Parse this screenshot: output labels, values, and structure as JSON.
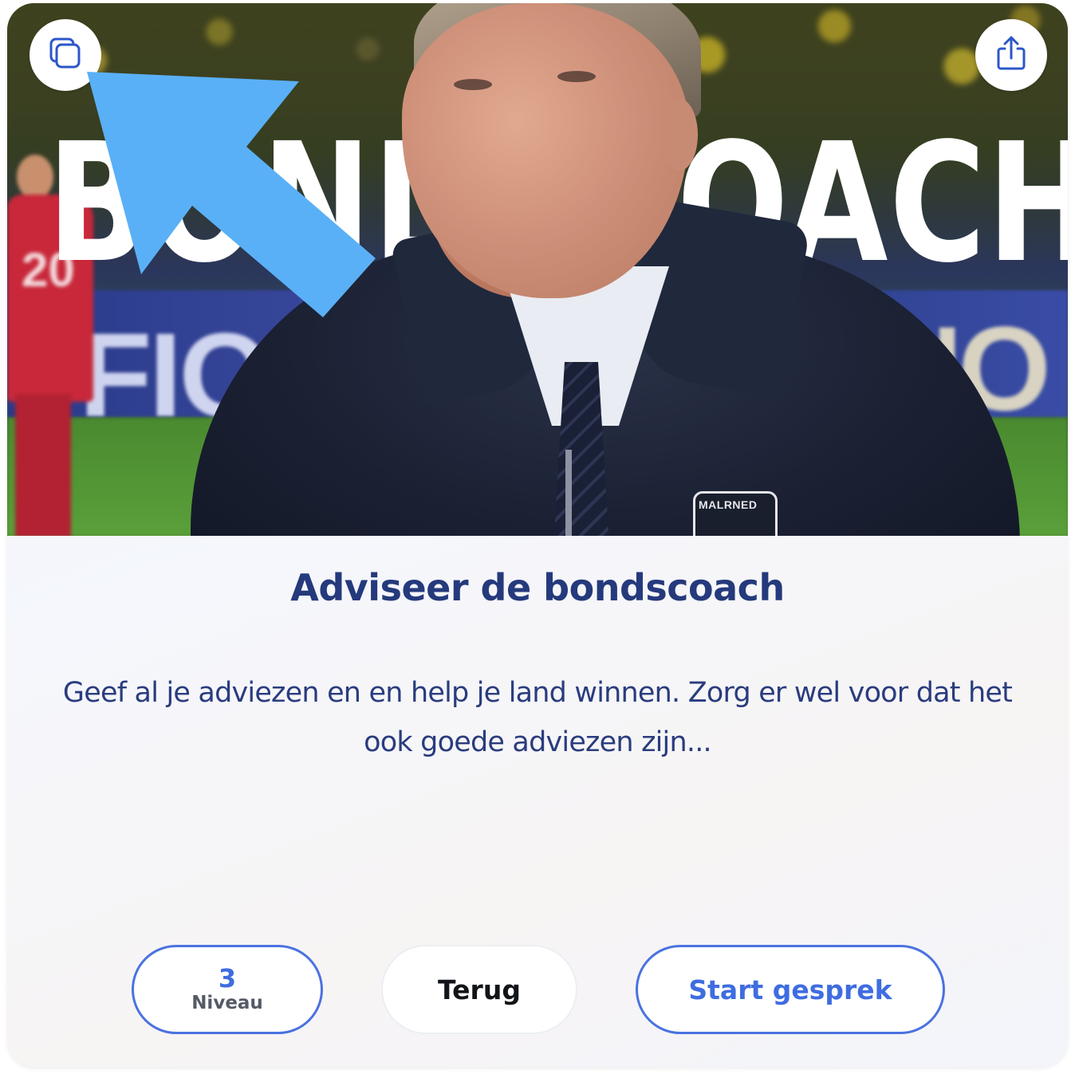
{
  "hero": {
    "title_overlay": "BONDSCOACH",
    "ad_text_left": "FIORA",
    "ad_text_right": "NO",
    "shirt_number": "20",
    "badge_text": "MALRNED"
  },
  "toolbar": {
    "duplicate_icon": "duplicate-icon",
    "share_icon": "share-icon"
  },
  "card": {
    "title": "Adviseer de bondscoach",
    "description": "Geef al je adviezen en en help je land winnen. Zorg er wel voor dat het ook goede adviezen zijn..."
  },
  "actions": {
    "level_value": "3",
    "level_label": "Niveau",
    "back_label": "Terug",
    "start_label": "Start gesprek"
  },
  "colors": {
    "accent": "#3f6de0",
    "title": "#253a7c",
    "arrow": "#5ab0f6"
  }
}
